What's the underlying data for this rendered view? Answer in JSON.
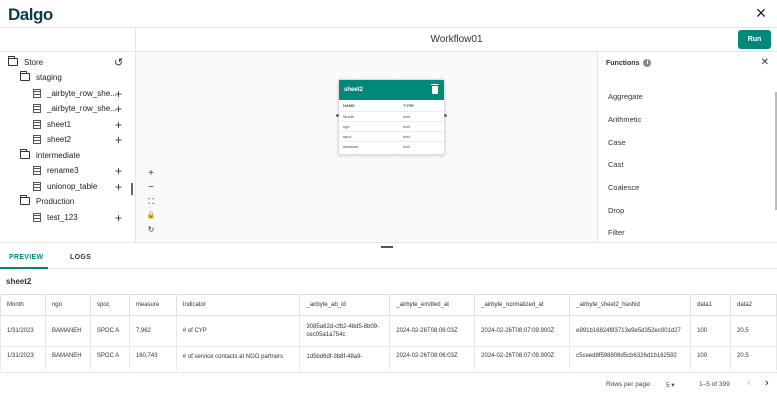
{
  "app": {
    "logo": "Dalgo",
    "close_icon": "×"
  },
  "workflow": {
    "title": "Workflow01",
    "run_label": "Run"
  },
  "tree": {
    "root": "Store",
    "folders": [
      {
        "name": "staging",
        "items": [
          "_airbyte_row_she...",
          "_airbyte_row_she...",
          "sheet1",
          "sheet2"
        ]
      },
      {
        "name": "intermediate",
        "items": [
          "rename3",
          "unionop_table"
        ]
      },
      {
        "name": "Production",
        "items": [
          "test_123"
        ]
      }
    ],
    "plus": "+"
  },
  "node": {
    "title": "sheet2",
    "headers": [
      "NAME",
      "TYPE"
    ],
    "rows": [
      [
        "Month",
        "text"
      ],
      [
        "ngo",
        "text"
      ],
      [
        "spoc",
        "text"
      ],
      [
        "measure",
        "text"
      ]
    ]
  },
  "zoom": {
    "in": "+",
    "out": "−",
    "fit": "⛶",
    "lock": "🔒",
    "reset": "↻"
  },
  "functions": {
    "title": "Functions",
    "info": "i",
    "close": "✕",
    "items": [
      "Aggregate",
      "Arithmetic",
      "Case",
      "Cast",
      "Coalesce",
      "Drop",
      "Filter"
    ]
  },
  "tabs": {
    "preview": "PREVIEW",
    "logs": "LOGS"
  },
  "preview": {
    "table_name": "sheet2",
    "columns": [
      "Month",
      "ngo",
      "spoc",
      "measure",
      "Indicator",
      "_airbyte_ab_id",
      "_airbyte_emitted_at",
      "_airbyte_normalized_at",
      "_airbyte_sheet2_hashid",
      "data1",
      "data2"
    ],
    "rows": [
      [
        "1/31/2023",
        "BAMANEH",
        "SPOC A",
        "7,962",
        "# of CYP",
        "3085a62d-cfb2-48d5-8b09-cec05a1a754c",
        "2024-02-26T08:06:03Z",
        "2024-02-26T08:07:09.900Z",
        "e991b16824f83713e9e5d352ec001d27",
        "100",
        "20.5"
      ],
      [
        "1/31/2023",
        "BAMANEH",
        "SPOC A",
        "160,743",
        "# of service contacts at NGO partners",
        "1d5bd6df-3b8f-48a9-",
        "2024-02-26T08:06:03Z",
        "2024-02-26T08:07:09.900Z",
        "c5ceed8f598808d5cb6326d1b162592",
        "100",
        "20.5"
      ]
    ]
  },
  "pager": {
    "rows_per_page_label": "Rows per page:",
    "rows_per_page": "5 ▾",
    "range": "1–5 of 399",
    "prev": "‹",
    "next": "›"
  }
}
